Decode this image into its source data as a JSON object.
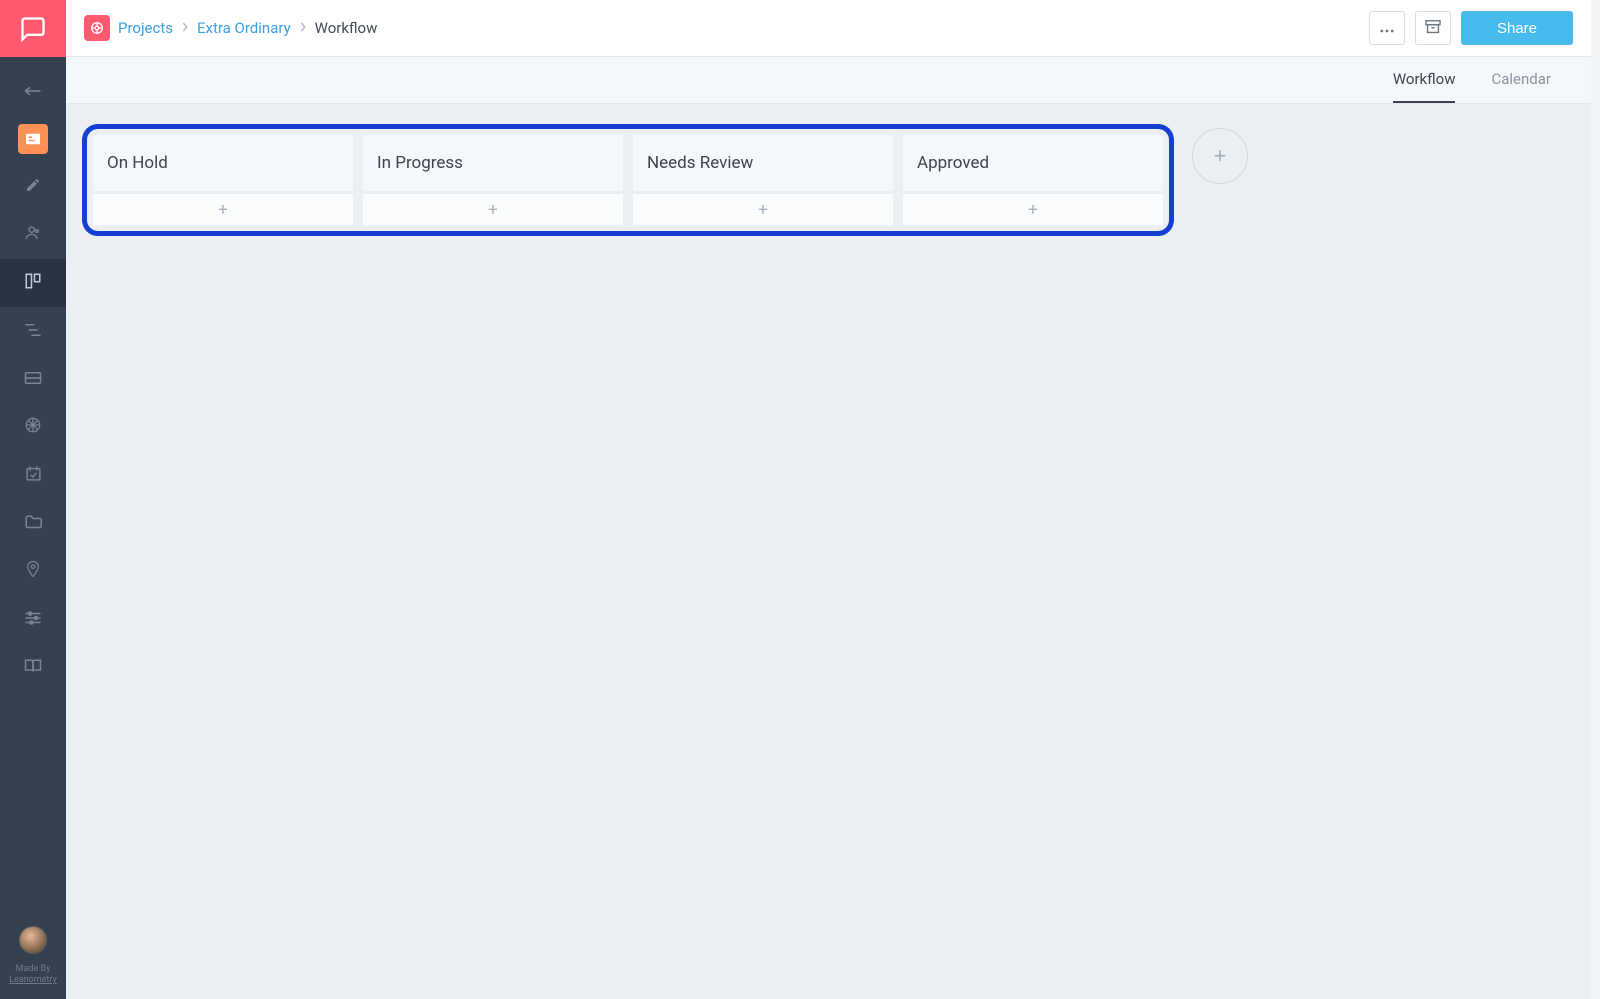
{
  "breadcrumb": {
    "projects_label": "Projects",
    "project_name": "Extra Ordinary",
    "current": "Workflow"
  },
  "topbar": {
    "share_label": "Share"
  },
  "tabs": {
    "workflow": "Workflow",
    "calendar": "Calendar"
  },
  "columns": [
    {
      "title": "On Hold"
    },
    {
      "title": "In Progress"
    },
    {
      "title": "Needs Review"
    },
    {
      "title": "Approved"
    }
  ],
  "sidebar_footer": {
    "made_by": "Made By",
    "company": "Leanometry"
  }
}
